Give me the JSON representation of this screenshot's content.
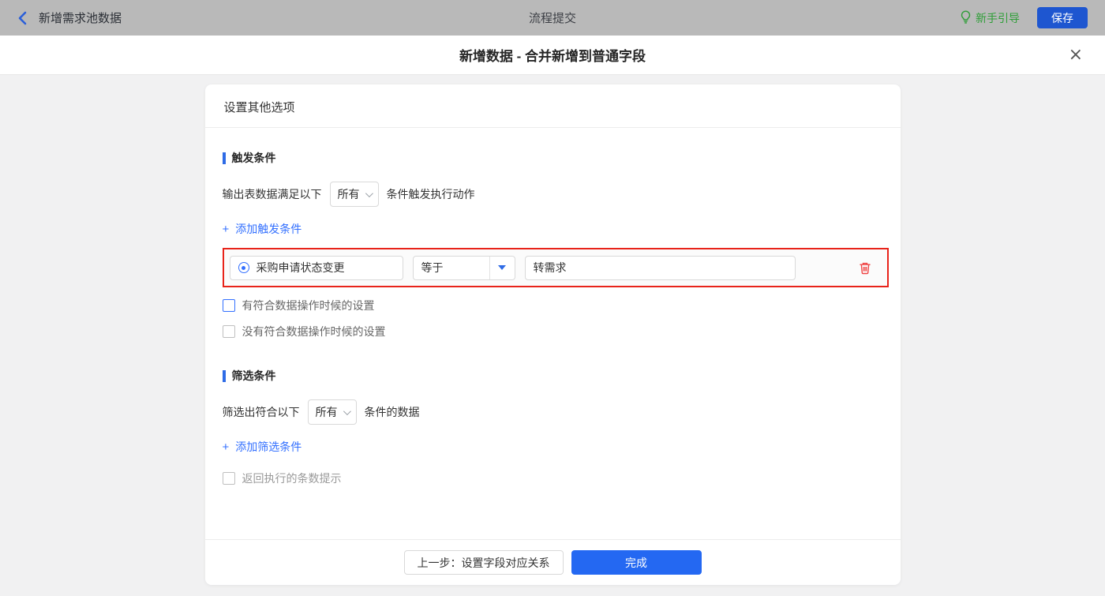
{
  "colors": {
    "accent_blue": "#2468f2",
    "link_blue": "#3370ff",
    "guide_green": "#2f9e38",
    "highlight_red": "#e8231a",
    "topbar_gray": "#b9b9b9"
  },
  "topbar": {
    "back_label": "新增需求池数据",
    "title": "流程提交",
    "guide_label": "新手引导",
    "save_label": "保存"
  },
  "dialog": {
    "title": "新增数据 - 合并新增到普通字段",
    "close_glyph": "×"
  },
  "card": {
    "header": "设置其他选项",
    "trigger_section": {
      "title": "触发条件",
      "sentence_prefix": "输出表数据满足以下",
      "match_select_value": "所有",
      "sentence_suffix": "条件触发执行动作",
      "add_plus": "+",
      "add_label": "添加触发条件",
      "condition_row": {
        "field": "采购申请状态变更",
        "operator": "等于",
        "value": "转需求"
      },
      "checkbox_has_label": "有符合数据操作时候的设置",
      "checkbox_none_label": "没有符合数据操作时候的设置"
    },
    "filter_section": {
      "title": "筛选条件",
      "sentence_prefix": "筛选出符合以下",
      "match_select_value": "所有",
      "sentence_suffix": "条件的数据",
      "add_plus": "+",
      "add_label": "添加筛选条件",
      "checkbox_count_label": "返回执行的条数提示"
    },
    "footer": {
      "prev_label": "上一步：设置字段对应关系",
      "done_label": "完成"
    }
  }
}
